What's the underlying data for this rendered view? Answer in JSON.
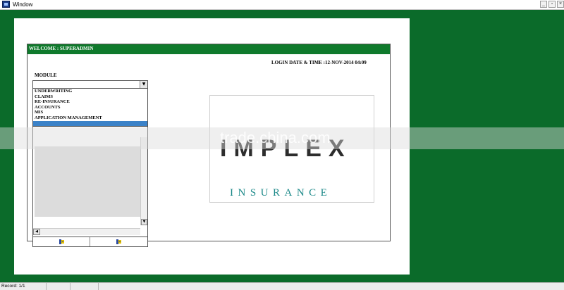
{
  "window": {
    "title": "Window",
    "minimize_glyph": "_",
    "restore_glyph": "▫",
    "close_glyph": "×"
  },
  "header": {
    "welcome": "WELCOME : SUPERADMIN",
    "login_info": "LOGIN DATE & TIME :12-NOV-2014 04:09"
  },
  "module": {
    "label": "MODULE",
    "selected_value": "",
    "options": [
      "UNDERWRITING",
      "CLAIMS",
      "RE-INSURANCE",
      "ACCOUNTS",
      "MIS",
      "APPLICATION MANAGEMENT",
      ""
    ],
    "highlighted_index": 6
  },
  "logo": {
    "word": "IMPLEX",
    "tagline": "INSURANCE"
  },
  "watermark": "trade.china.com",
  "status": {
    "record": "Record: 1/1"
  },
  "colors": {
    "background_green": "#0b6b2a",
    "bar_green": "#0f7a2c",
    "highlight_blue": "#3b82c8",
    "tagline_teal": "#1e8a8a"
  }
}
